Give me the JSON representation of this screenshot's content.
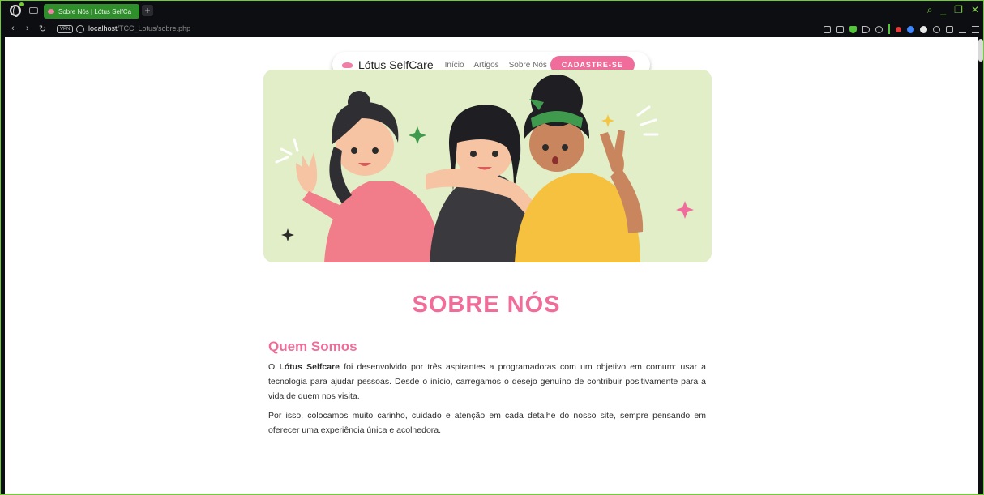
{
  "browser": {
    "tab_title": "Sobre Nós | Lótus SelfCa",
    "new_tab_symbol": "+",
    "url_host": "localhost",
    "url_path": "/TCC_Lotus/sobre.php",
    "vpn_label": "VPN",
    "nav_back": "‹",
    "nav_forward": "›",
    "nav_reload": "↻",
    "win_search": "⌕",
    "win_min": "_",
    "win_restore": "❐",
    "win_close": "✕",
    "accent_color": "#6fcf2e"
  },
  "site": {
    "brand": "Lótus SelfCare",
    "nav": [
      "Início",
      "Artigos",
      "Sobre Nós"
    ],
    "cta": "CADASTRE-SE",
    "accent_color": "#f06d9b",
    "hero_background": "#e2eec8"
  },
  "content": {
    "heading": "SOBRE NÓS",
    "section_title": "Quem Somos",
    "p1_prefix": "O ",
    "p1_bold": "Lótus Selfcare",
    "p1_rest": " foi desenvolvido por três aspirantes a programadoras com um objetivo em comum: usar a tecnologia para ajudar pessoas. Desde o início, carregamos o desejo genuíno de contribuir positivamente para a vida de quem nos visita.",
    "p2": "Por isso, colocamos muito carinho, cuidado e atenção em cada detalhe do nosso site, sempre pensando em oferecer uma experiência única e acolhedora."
  }
}
